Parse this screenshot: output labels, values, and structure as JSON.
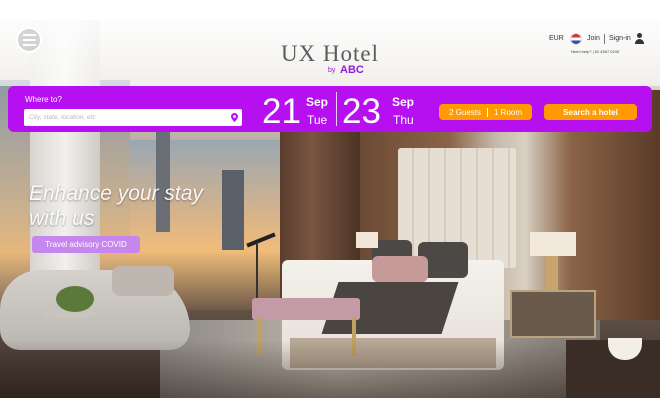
{
  "header": {
    "logo_title": "UX Hotel",
    "logo_by": "by",
    "logo_brand": "ABC",
    "currency": "EUR",
    "join_label": "Join",
    "signin_label": "Sign-in",
    "help_text": "Need help? | 62 4567 0240",
    "icons": [
      "menu-icon",
      "flag-icon",
      "user-icon"
    ]
  },
  "booking": {
    "where_label": "Where to?",
    "search_placeholder": "City, state, location, etc",
    "checkin": {
      "day": "21",
      "month": "Sep",
      "weekday": "Tue"
    },
    "checkout": {
      "day": "23",
      "month": "Sep",
      "weekday": "Thu"
    },
    "guests": "2 Guests",
    "rooms": "1 Room",
    "search_button": "Search a hotel",
    "icons": [
      "location-pin-icon"
    ]
  },
  "hero": {
    "headline_line1": "Enhance your stay",
    "headline_line2": "with us",
    "advisory_button": "Travel advisory COVID"
  },
  "colors": {
    "accent_purple": "#b60ff0",
    "accent_orange": "#ff9a00",
    "advisory_purple": "#c586ee",
    "brand_purple": "#8f1fd6"
  }
}
